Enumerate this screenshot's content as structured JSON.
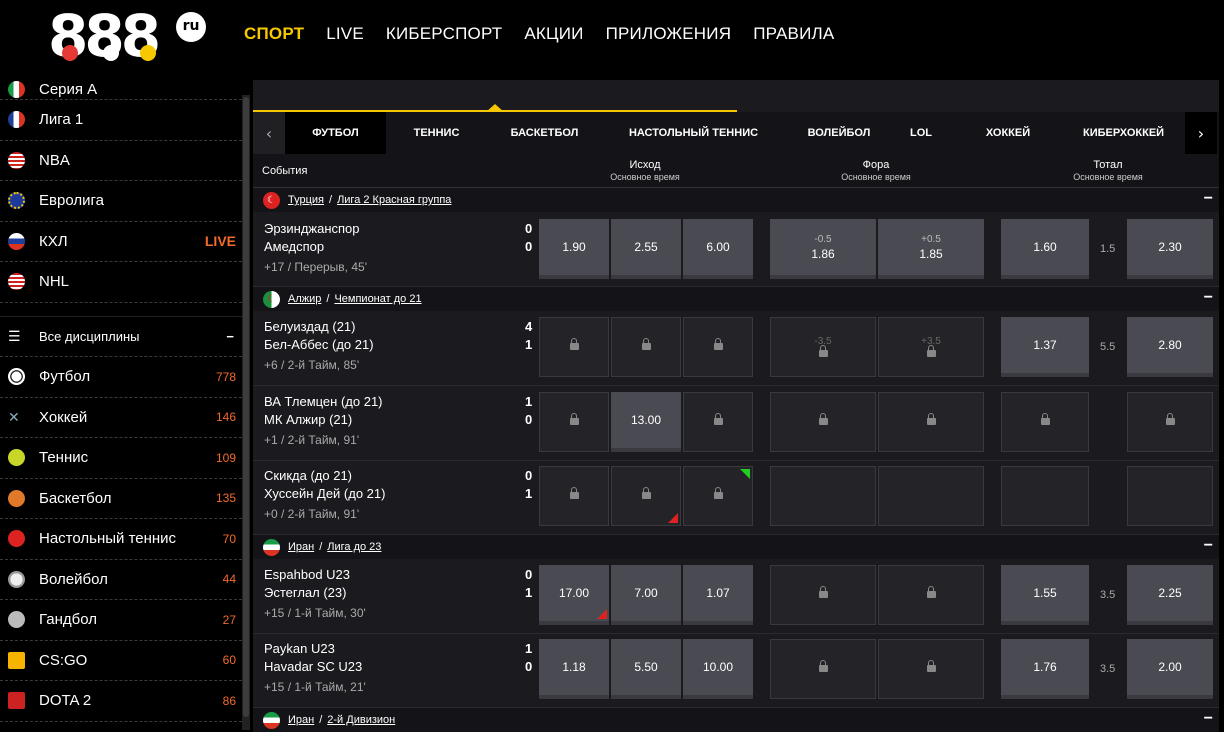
{
  "header": {
    "logo_text": "888",
    "logo_suffix": "ru",
    "nav": [
      "СПОРТ",
      "LIVE",
      "КИБЕРСПОРТ",
      "АКЦИИ",
      "ПРИЛОЖЕНИЯ",
      "ПРАВИЛА"
    ]
  },
  "sidebar": {
    "top_leagues": [
      {
        "label": "Серия А",
        "flag": "italy-flag-icon"
      },
      {
        "label": "Лига 1",
        "flag": "france-flag-icon"
      },
      {
        "label": "NBA",
        "flag": "usa-flag-icon"
      },
      {
        "label": "Евролига",
        "flag": "eu-flag-icon"
      },
      {
        "label": "КХЛ",
        "flag": "russia-flag-icon",
        "badge": "LIVE"
      },
      {
        "label": "NHL",
        "flag": "usa-flag-icon"
      }
    ],
    "all_label": "Все дисциплины",
    "all_toggle": "−",
    "sports": [
      {
        "label": "Футбол",
        "count": "778",
        "icon": "football-icon"
      },
      {
        "label": "Хоккей",
        "count": "146",
        "icon": "hockey-icon"
      },
      {
        "label": "Теннис",
        "count": "109",
        "icon": "tennis-icon"
      },
      {
        "label": "Баскетбол",
        "count": "135",
        "icon": "basketball-icon"
      },
      {
        "label": "Настольный теннис",
        "count": "70",
        "icon": "table-tennis-icon"
      },
      {
        "label": "Волейбол",
        "count": "44",
        "icon": "volleyball-icon"
      },
      {
        "label": "Гандбол",
        "count": "27",
        "icon": "handball-icon"
      },
      {
        "label": "CS:GO",
        "count": "60",
        "icon": "csgo-icon"
      },
      {
        "label": "DOTA 2",
        "count": "86",
        "icon": "dota2-icon"
      }
    ]
  },
  "tabs": {
    "prev": "‹",
    "next": "›",
    "items": [
      "ФУТБОЛ",
      "ТЕННИС",
      "БАСКЕТБОЛ",
      "НАСТОЛЬНЫЙ ТЕННИС",
      "ВОЛЕЙБОЛ",
      "LOL",
      "ХОККЕЙ",
      "КИБЕРХОККЕЙ"
    ]
  },
  "columns": {
    "events": "События",
    "outcome": "Исход",
    "outcome_sub": "Основное время",
    "handicap": "Фора",
    "handicap_sub": "Основное время",
    "total": "Тотал",
    "total_sub": "Основное время"
  },
  "leagues": [
    {
      "country": "Турция",
      "name": "Лига 2 Красная группа",
      "toggle": "−",
      "events": [
        {
          "team1": "Эрзинджанспор",
          "team2": "Амедспор",
          "score1": "0",
          "score2": "0",
          "info": "+17 / Перерыв, 45'",
          "o1": "1.90",
          "ox": "2.55",
          "o2": "6.00",
          "h1_line": "-0.5",
          "h1": "1.86",
          "h2_line": "+0.5",
          "h2": "1.85",
          "t_over": "1.60",
          "t_line": "1.5",
          "t_under": "2.30"
        }
      ]
    },
    {
      "country": "Алжир",
      "name": "Чемпионат до 21",
      "toggle": "−",
      "events": [
        {
          "team1": "Белуиздад (21)",
          "team2": "Бел-Аббес (до 21)",
          "score1": "4",
          "score2": "1",
          "info": "+6 / 2-й Тайм, 85'",
          "h1_line": "-3.5",
          "h2_line": "+3.5",
          "t_over": "1.37",
          "t_line": "5.5",
          "t_under": "2.80"
        },
        {
          "team1": "ВА Тлемцен (до 21)",
          "team2": "МК Алжир (21)",
          "score1": "1",
          "score2": "0",
          "info": "+1 / 2-й Тайм, 91'",
          "ox": "13.00"
        },
        {
          "team1": "Скикда (до 21)",
          "team2": "Хуссейн Дей (до 21)",
          "score1": "0",
          "score2": "1",
          "info": "+0 / 2-й Тайм, 91'"
        }
      ]
    },
    {
      "country": "Иран",
      "name": "Лига до 23",
      "toggle": "−",
      "events": [
        {
          "team1": "Espahbod U23",
          "team2": "Эстеглал (23)",
          "score1": "0",
          "score2": "1",
          "info": "+15 / 1-й Тайм, 30'",
          "o1": "17.00",
          "ox": "7.00",
          "o2": "1.07",
          "t_over": "1.55",
          "t_line": "3.5",
          "t_under": "2.25"
        },
        {
          "team1": "Paykan U23",
          "team2": "Havadar SC U23",
          "score1": "1",
          "score2": "0",
          "info": "+15 / 1-й Тайм, 21'",
          "o1": "1.18",
          "ox": "5.50",
          "o2": "10.00",
          "t_over": "1.76",
          "t_line": "3.5",
          "t_under": "2.00"
        }
      ]
    },
    {
      "country": "Иран",
      "name": "2-й Дивизион",
      "toggle": "−"
    }
  ],
  "colors": {
    "accent": "#f6c800",
    "live": "#f26b2a",
    "cell": "#4a4a52",
    "locked": "#242428"
  }
}
